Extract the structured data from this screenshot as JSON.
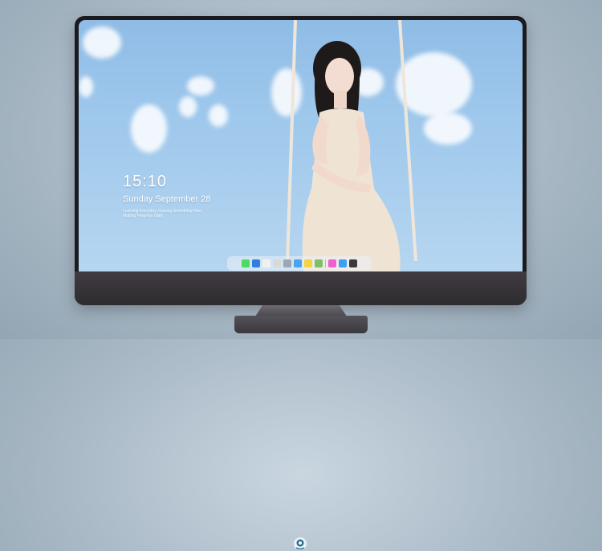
{
  "lockscreen": {
    "time": "15:10",
    "date": "Sunday September 28",
    "note": "Learning Everyday, Gaining Something New, Making Progress Daily"
  },
  "dock": {
    "apps": [
      {
        "icon": "messages-icon",
        "color": "#4cd964"
      },
      {
        "icon": "finder-icon",
        "color": "#2f7fe0"
      },
      {
        "icon": "safari-icon",
        "color": "#f0f0f0"
      },
      {
        "icon": "notes-icon",
        "color": "#d9d9d9"
      },
      {
        "icon": "launchpad-icon",
        "color": "#9aa7b4"
      },
      {
        "icon": "mail-icon",
        "color": "#49a3f1"
      },
      {
        "icon": "stickies-icon",
        "color": "#f5d442"
      },
      {
        "icon": "preview-icon",
        "color": "#7fbf6a"
      },
      {
        "icon": "music-icon",
        "color": "#f05fd0"
      },
      {
        "icon": "app-store-icon",
        "color": "#3aa0f5"
      },
      {
        "icon": "camera-icon",
        "color": "#3a3a3a"
      }
    ]
  },
  "colors": {
    "sky": "#9fc8ec",
    "monitor_bezel": "#1b1b1f",
    "chin": "#3a363b"
  }
}
